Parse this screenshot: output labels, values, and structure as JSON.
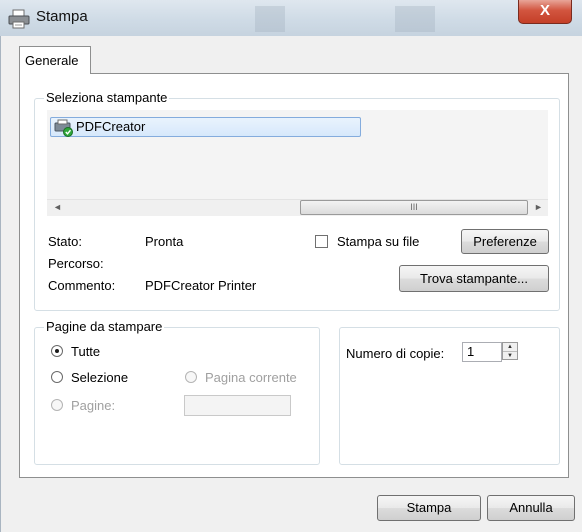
{
  "window": {
    "title": "Stampa",
    "close_label": "X"
  },
  "tabs": [
    {
      "label": "Generale"
    }
  ],
  "printer_group": {
    "label": "Seleziona stampante",
    "printers": [
      {
        "name": "PDFCreator",
        "selected": true
      }
    ],
    "scroll_thumb_grip": "III",
    "scroll_left": "◄",
    "scroll_right": "►"
  },
  "status": {
    "stato_label": "Stato:",
    "stato_value": "Pronta",
    "percorso_label": "Percorso:",
    "percorso_value": "",
    "commento_label": "Commento:",
    "commento_value": "PDFCreator Printer"
  },
  "print_to_file": {
    "label": "Stampa su file",
    "checked": false
  },
  "buttons": {
    "preferenze": "Preferenze",
    "trova": "Trova stampante...",
    "stampa": "Stampa",
    "annulla": "Annulla"
  },
  "pages_group": {
    "label": "Pagine da stampare",
    "options": {
      "tutte": "Tutte",
      "selezione": "Selezione",
      "pagina_corrente": "Pagina corrente",
      "pagine": "Pagine:"
    },
    "selected": "tutte",
    "pages_input": ""
  },
  "copies": {
    "label": "Numero di copie:",
    "value": "1"
  }
}
